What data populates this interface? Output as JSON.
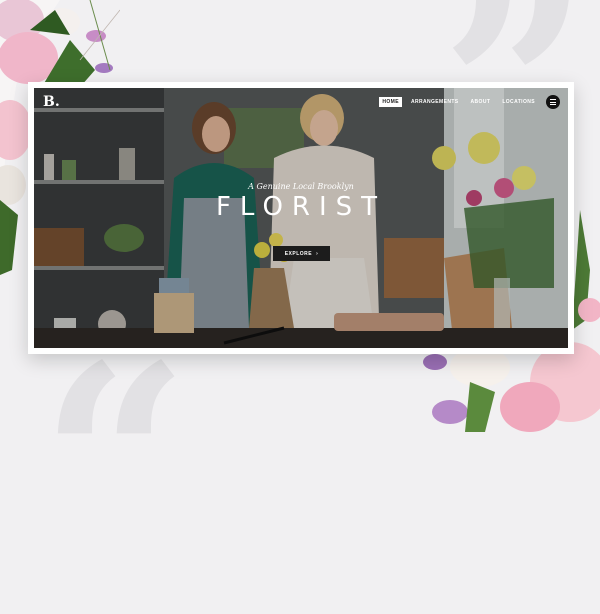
{
  "site": {
    "logo": "B.",
    "nav": [
      {
        "label": "HOME",
        "active": true
      },
      {
        "label": "ARRANGEMENTS",
        "active": false
      },
      {
        "label": "ABOUT",
        "active": false
      },
      {
        "label": "LOCATIONS",
        "active": false
      }
    ],
    "menu_icon": "hamburger-icon"
  },
  "hero": {
    "tagline": "A Genuine Local Brooklyn",
    "headline": "FLORIST",
    "cta_label": "EXPLORE",
    "cta_icon": "chevron-right-icon"
  },
  "colors": {
    "background": "#f1f0f2",
    "quote_marks": "#e2e1e4",
    "cta_bg": "#1c1c1c",
    "text": "#ffffff"
  }
}
